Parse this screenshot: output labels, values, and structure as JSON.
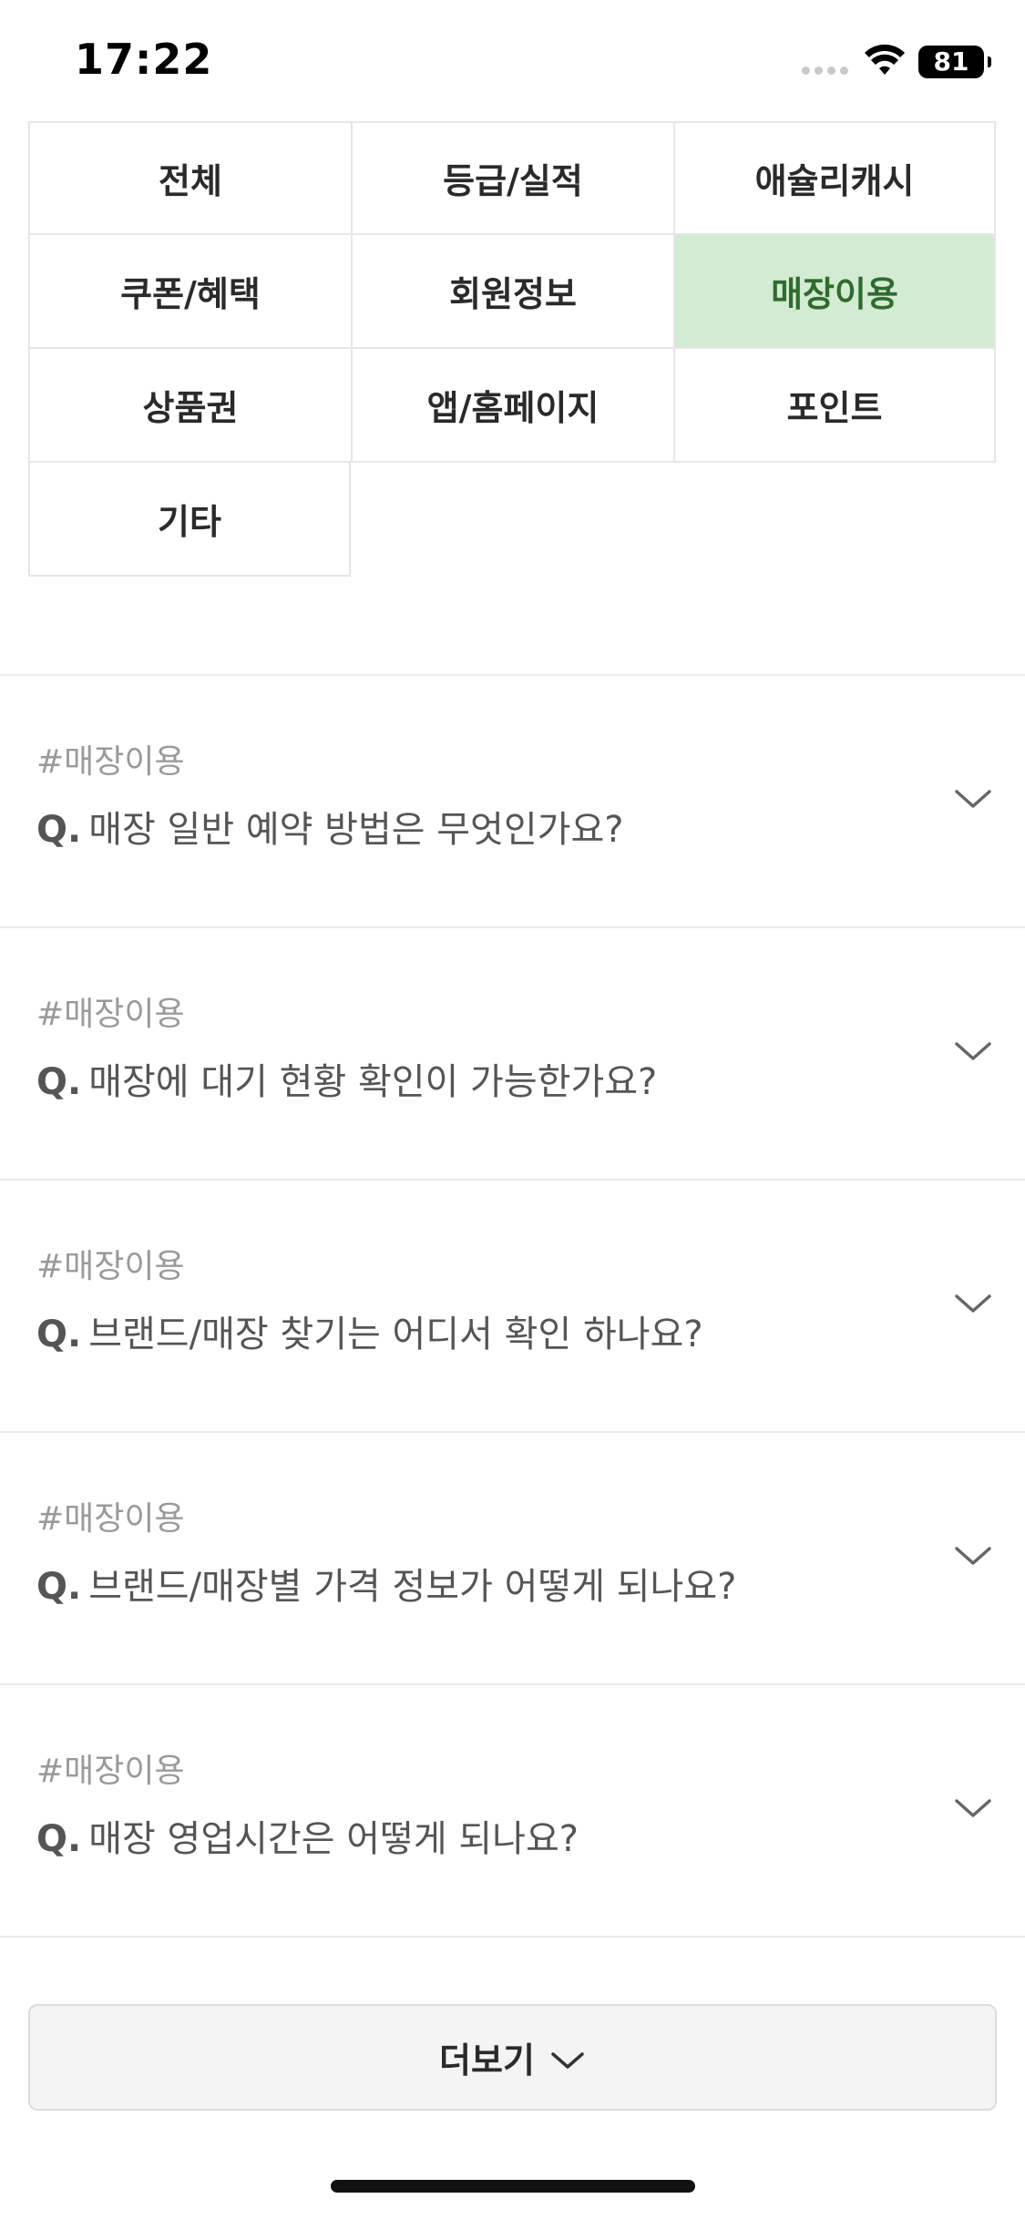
{
  "status_bar": {
    "time": "17:22",
    "battery": "81"
  },
  "categories": [
    {
      "label": "전체",
      "active": false
    },
    {
      "label": "등급/실적",
      "active": false
    },
    {
      "label": "애슐리캐시",
      "active": false
    },
    {
      "label": "쿠폰/혜택",
      "active": false
    },
    {
      "label": "회원정보",
      "active": false
    },
    {
      "label": "매장이용",
      "active": true
    },
    {
      "label": "상품권",
      "active": false
    },
    {
      "label": "앱/홈페이지",
      "active": false
    },
    {
      "label": "포인트",
      "active": false
    },
    {
      "label": "기타",
      "active": false
    }
  ],
  "faq": {
    "q_prefix": "Q.",
    "items": [
      {
        "tag": "#매장이용",
        "question": "매장 일반 예약 방법은 무엇인가요?"
      },
      {
        "tag": "#매장이용",
        "question": "매장에 대기 현황 확인이 가능한가요?"
      },
      {
        "tag": "#매장이용",
        "question": "브랜드/매장 찾기는 어디서 확인 하나요?"
      },
      {
        "tag": "#매장이용",
        "question": "브랜드/매장별 가격 정보가 어떻게 되나요?"
      },
      {
        "tag": "#매장이용",
        "question": "매장 영업시간은 어떻게 되나요?"
      }
    ]
  },
  "more_button": {
    "label": "더보기"
  },
  "colors": {
    "active_bg": "#d3ebd3",
    "active_text": "#2f6b2f",
    "border": "#e6e6e6"
  }
}
